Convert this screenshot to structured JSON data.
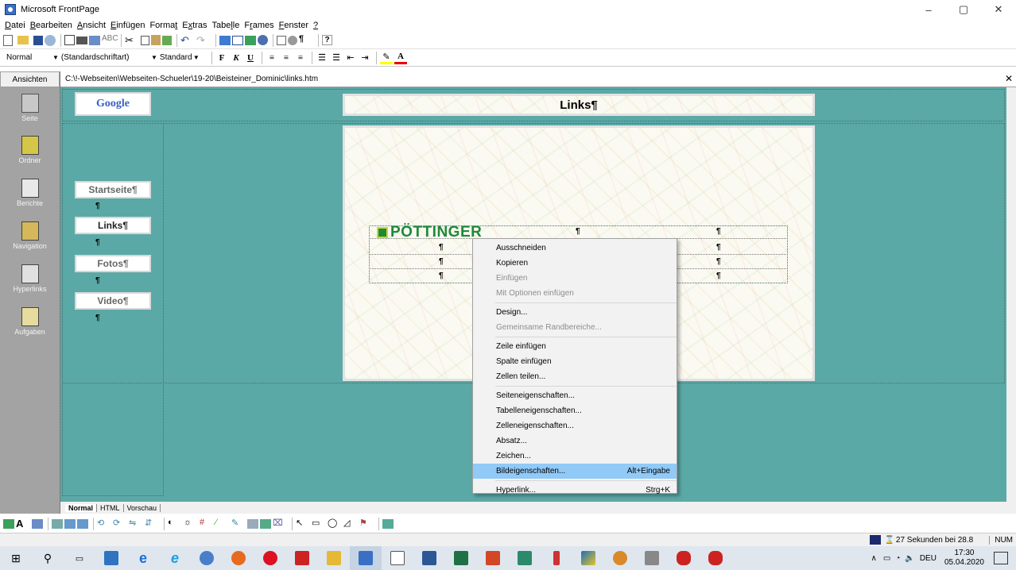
{
  "window": {
    "title": "Microsoft FrontPage",
    "min": "–",
    "max": "▢",
    "close": "✕"
  },
  "menu": [
    {
      "pre": "",
      "u": "D",
      "post": "atei"
    },
    {
      "pre": "",
      "u": "B",
      "post": "earbeiten"
    },
    {
      "pre": "",
      "u": "A",
      "post": "nsicht"
    },
    {
      "pre": "",
      "u": "E",
      "post": "infügen"
    },
    {
      "pre": "Forma",
      "u": "t",
      "post": ""
    },
    {
      "pre": "E",
      "u": "x",
      "post": "tras"
    },
    {
      "pre": "Tabe",
      "u": "l",
      "post": "le"
    },
    {
      "pre": "F",
      "u": "r",
      "post": "ames"
    },
    {
      "pre": "",
      "u": "F",
      "post": "enster"
    },
    {
      "pre": "",
      "u": "?",
      "post": ""
    }
  ],
  "format_toolbar": {
    "style": "Normal",
    "font": "(Standardschriftart)",
    "size": "Standard",
    "bold": "F",
    "italic": "K",
    "underline": "U"
  },
  "views": {
    "header": "Ansichten",
    "items": [
      "Seite",
      "Ordner",
      "Berichte",
      "Navigation",
      "Hyperlinks",
      "Aufgaben"
    ]
  },
  "path": "C:\\!-Webseiten\\Webseiten-Schueler\\19-20\\Beisteiner_Dominic\\links.htm",
  "page": {
    "google": "Google",
    "heading": "Links¶",
    "nav": [
      "Startseite¶",
      "Links¶",
      "Fotos¶",
      "Video¶"
    ],
    "logo": "PÖTTINGER",
    "pilcrow": "¶"
  },
  "context_menu": [
    {
      "label": "Ausschneiden",
      "shortcut": "",
      "state": "normal"
    },
    {
      "label": "Kopieren",
      "shortcut": "",
      "state": "normal"
    },
    {
      "label": "Einfügen",
      "shortcut": "",
      "state": "disabled"
    },
    {
      "label": "Mit Optionen einfügen",
      "shortcut": "",
      "state": "disabled"
    },
    {
      "sep": true
    },
    {
      "label": "Design...",
      "shortcut": "",
      "state": "normal"
    },
    {
      "label": "Gemeinsame Randbereiche...",
      "shortcut": "",
      "state": "disabled"
    },
    {
      "sep": true
    },
    {
      "label": "Zeile einfügen",
      "shortcut": "",
      "state": "normal"
    },
    {
      "label": "Spalte einfügen",
      "shortcut": "",
      "state": "normal"
    },
    {
      "label": "Zellen teilen...",
      "shortcut": "",
      "state": "normal"
    },
    {
      "sep": true
    },
    {
      "label": "Seiteneigenschaften...",
      "shortcut": "",
      "state": "normal"
    },
    {
      "label": "Tabelleneigenschaften...",
      "shortcut": "",
      "state": "normal"
    },
    {
      "label": "Zelleneigenschaften...",
      "shortcut": "",
      "state": "normal"
    },
    {
      "label": "Absatz...",
      "shortcut": "",
      "state": "normal"
    },
    {
      "label": "Zeichen...",
      "shortcut": "",
      "state": "normal"
    },
    {
      "label": "Bildeigenschaften...",
      "shortcut": "Alt+Eingabe",
      "state": "hover"
    },
    {
      "sep": true
    },
    {
      "label": "Hyperlink...",
      "shortcut": "Strg+K",
      "state": "normal"
    }
  ],
  "tabs": [
    "Normal",
    "HTML",
    "Vorschau"
  ],
  "status": {
    "download": "27 Sekunden bei 28.8",
    "num": "NUM"
  },
  "tray": {
    "lang": "DEU",
    "time": "17:30",
    "date": "05.04.2020"
  },
  "colors": {
    "canvas": "#5ba9a6",
    "views": "#a3a3a3",
    "hover": "#91c9f7",
    "logo": "#1d8a3a"
  }
}
